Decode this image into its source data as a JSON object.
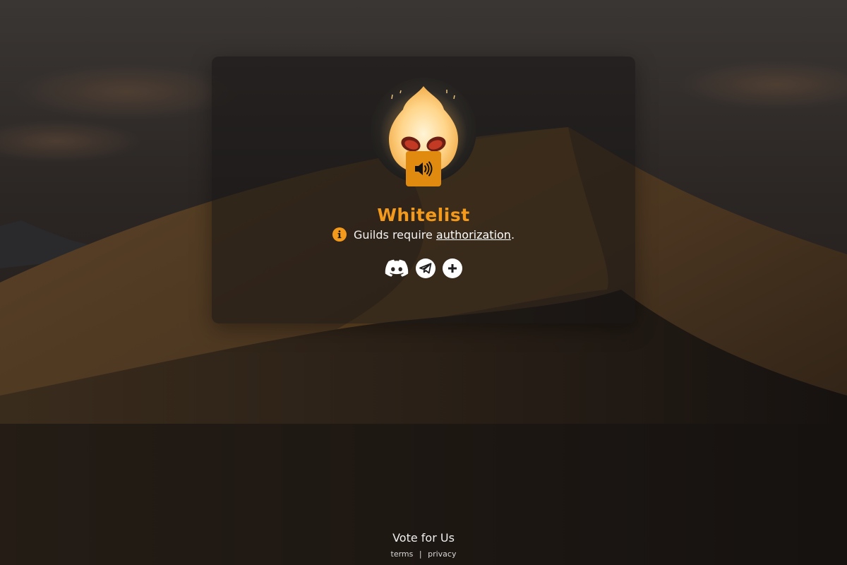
{
  "page": {
    "title": "Whitelist",
    "accent_color": "#f39a1c",
    "button_color": "#e08a0f"
  },
  "avatar": {
    "icon": "alien-flame-avatar"
  },
  "sound_button": {
    "icon": "volume-icon"
  },
  "notice": {
    "icon": "info-icon",
    "prefix": "Guilds require ",
    "link": "authorization",
    "suffix": "."
  },
  "socials": [
    {
      "name": "discord",
      "icon": "discord-icon"
    },
    {
      "name": "telegram",
      "icon": "telegram-icon"
    },
    {
      "name": "add",
      "icon": "plus-icon"
    }
  ],
  "footer": {
    "vote": "Vote for Us",
    "terms": "terms",
    "separator": "|",
    "privacy": "privacy"
  }
}
